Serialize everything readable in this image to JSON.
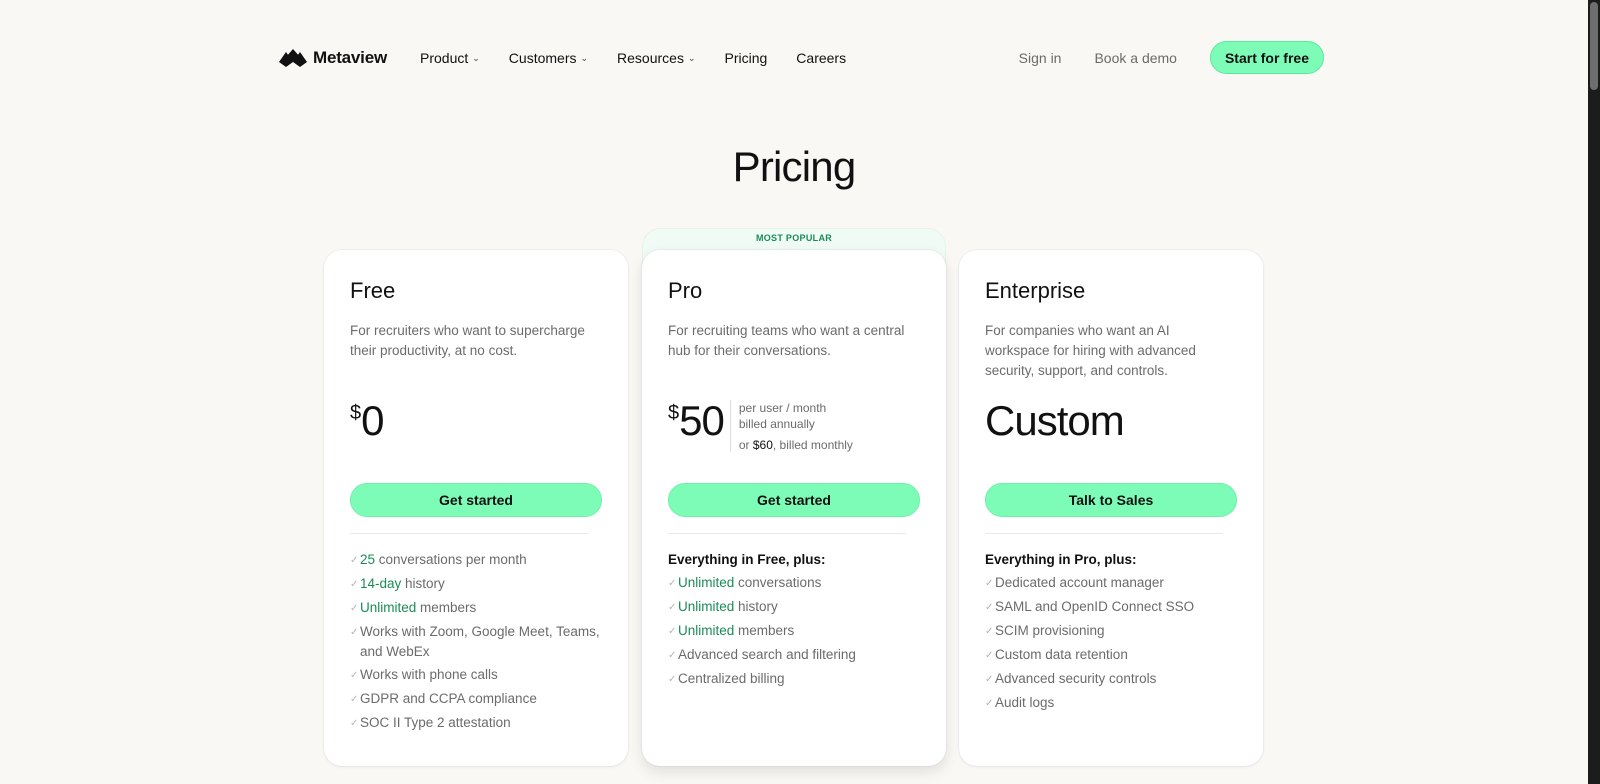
{
  "brand": {
    "name": "Metaview"
  },
  "nav": {
    "links": [
      {
        "label": "Product",
        "dropdown": true
      },
      {
        "label": "Customers",
        "dropdown": true
      },
      {
        "label": "Resources",
        "dropdown": true
      },
      {
        "label": "Pricing",
        "dropdown": false
      },
      {
        "label": "Careers",
        "dropdown": false
      }
    ],
    "sign_in": "Sign in",
    "book_demo": "Book a demo",
    "start_free": "Start for free"
  },
  "page": {
    "title": "Pricing"
  },
  "colors": {
    "accent": "#7dfcb8",
    "highlight_text": "#1a8b58",
    "background": "#faf8f5"
  },
  "plans": {
    "popular_badge": "MOST POPULAR",
    "free": {
      "name": "Free",
      "description": "For recruiters who want to supercharge their productivity, at no cost.",
      "currency": "$",
      "price": "0",
      "button": "Get started",
      "features": [
        {
          "hl": "25",
          "text": " conversations per month"
        },
        {
          "hl": "14-day",
          "text": " history"
        },
        {
          "hl": "Unlimited",
          "text": " members"
        },
        {
          "hl": "",
          "text": "Works with Zoom, Google Meet, Teams, and WebEx"
        },
        {
          "hl": "",
          "text": "Works with phone calls"
        },
        {
          "hl": "",
          "text": "GDPR and CCPA compliance"
        },
        {
          "hl": "",
          "text": "SOC II Type 2 attestation"
        }
      ]
    },
    "pro": {
      "name": "Pro",
      "description": "For recruiting teams who want a central hub for their conversations.",
      "currency": "$",
      "price": "50",
      "price_note_1": "per user / month",
      "price_note_2": "billed annually",
      "price_note_3_prefix": "or ",
      "price_note_3_amount": "$60",
      "price_note_3_suffix": ", billed monthly",
      "button": "Get started",
      "features_head": "Everything in Free, plus:",
      "features": [
        {
          "hl": "Unlimited",
          "text": " conversations"
        },
        {
          "hl": "Unlimited",
          "text": " history"
        },
        {
          "hl": "Unlimited",
          "text": " members"
        },
        {
          "hl": "",
          "text": "Advanced search and filtering"
        },
        {
          "hl": "",
          "text": "Centralized billing"
        }
      ]
    },
    "enterprise": {
      "name": "Enterprise",
      "description": "For companies who want an AI workspace for hiring with advanced security, support, and controls.",
      "price": "Custom",
      "button": "Talk to Sales",
      "features_head": "Everything in Pro, plus:",
      "features": [
        {
          "hl": "",
          "text": "Dedicated account manager"
        },
        {
          "hl": "",
          "text": "SAML and OpenID Connect SSO"
        },
        {
          "hl": "",
          "text": "SCIM provisioning"
        },
        {
          "hl": "",
          "text": "Custom data retention"
        },
        {
          "hl": "",
          "text": "Advanced security controls"
        },
        {
          "hl": "",
          "text": "Audit logs"
        }
      ]
    }
  }
}
